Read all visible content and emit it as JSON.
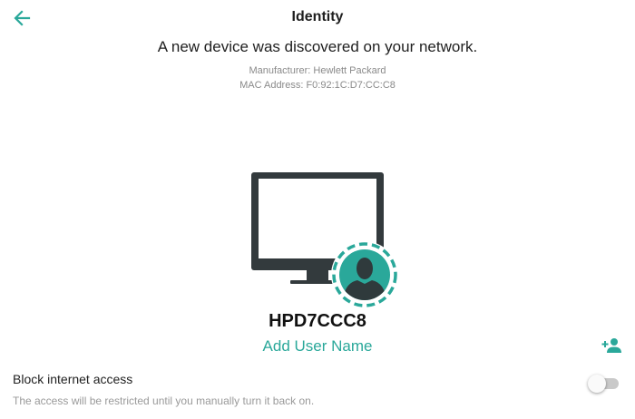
{
  "header": {
    "title": "Identity"
  },
  "discovery": {
    "headline": "A new device was discovered on your network.",
    "manufacturer": "Manufacturer: Hewlett Packard",
    "mac_address": "MAC Address: F0:92:1C:D7:CC:C8"
  },
  "device": {
    "name": "HPD7CCC8",
    "add_user_label": "Add User Name"
  },
  "block_internet": {
    "label": "Block internet access",
    "description": "The access will be restricted until you manually turn it back on.",
    "enabled": false
  },
  "icons": {
    "back": "arrow-left-icon",
    "monitor": "monitor-icon",
    "user_badge": "person-avatar-icon",
    "add_person": "person-add-icon"
  },
  "colors": {
    "accent": "#2aa89a",
    "monitor": "#333a3d"
  }
}
